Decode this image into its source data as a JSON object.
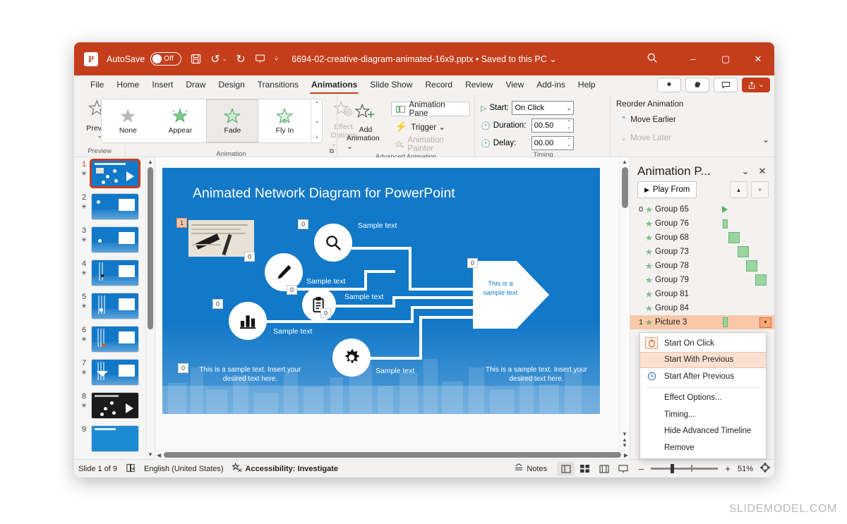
{
  "titlebar": {
    "app_logo": "powerpoint-logo",
    "autosave_label": "AutoSave",
    "autosave_state": "Off",
    "save_icon": "save-icon",
    "undo_icon": "undo-icon",
    "redo_icon": "redo-icon",
    "present_icon": "present-icon",
    "customize_icon": "chevron-down-icon",
    "document_title": "6694-02-creative-diagram-animated-16x9.pptx • Saved to this PC ⌄",
    "search_icon": "search-icon",
    "minimize": "–",
    "maximize": "▢",
    "close": "✕",
    "bg_color": "#c43e1c"
  },
  "tabs": [
    {
      "label": "File",
      "active": false
    },
    {
      "label": "Home",
      "active": false
    },
    {
      "label": "Insert",
      "active": false
    },
    {
      "label": "Draw",
      "active": false
    },
    {
      "label": "Design",
      "active": false
    },
    {
      "label": "Transitions",
      "active": false
    },
    {
      "label": "Animations",
      "active": true
    },
    {
      "label": "Slide Show",
      "active": false
    },
    {
      "label": "Record",
      "active": false
    },
    {
      "label": "Review",
      "active": false
    },
    {
      "label": "View",
      "active": false
    },
    {
      "label": "Add-ins",
      "active": false
    },
    {
      "label": "Help",
      "active": false
    }
  ],
  "tab_right": {
    "record_btn": "record-icon",
    "copilot_btn": "copilot-icon",
    "comments_btn": "comment-icon",
    "share_btn": "share-icon",
    "share_caret": "⌄"
  },
  "ribbon": {
    "preview": {
      "label": "Preview",
      "caret": "⌄",
      "group_title": "Preview",
      "icon": "preview-star-icon"
    },
    "animation": {
      "group_title": "Animation",
      "items": [
        {
          "label": "None",
          "icon": "star-outline-icon",
          "selected": false
        },
        {
          "label": "Appear",
          "icon": "star-appear-icon",
          "selected": false
        },
        {
          "label": "Fade",
          "icon": "star-fade-icon",
          "selected": true
        },
        {
          "label": "Fly In",
          "icon": "star-flyin-icon",
          "selected": false
        }
      ],
      "effect_options_label_1": "Effect",
      "effect_options_label_2": "Options ⌄",
      "effect_options_disabled": true,
      "dialog_launcher": "dialog-launcher-icon"
    },
    "advanced": {
      "group_title": "Advanced Animation",
      "add_animation_label_1": "Add",
      "add_animation_label_2": "Animation ⌄",
      "animation_pane_label": "Animation Pane",
      "trigger_label": "Trigger ⌄",
      "animation_painter_label": "Animation Painter",
      "animation_painter_disabled": true
    },
    "timing": {
      "group_title": "Timing",
      "start_label": "Start:",
      "start_value": "On Click",
      "duration_label": "Duration:",
      "duration_value": "00.50",
      "delay_label": "Delay:",
      "delay_value": "00.00",
      "reorder_title": "Reorder Animation",
      "move_earlier": "Move Earlier",
      "move_later": "Move Later",
      "move_later_disabled": true
    },
    "collapse_icon": "chevron-down-icon"
  },
  "thumbnails": {
    "slides": [
      {
        "number": "1",
        "selected": true,
        "style": "diagram"
      },
      {
        "number": "2",
        "selected": false,
        "style": "card"
      },
      {
        "number": "3",
        "selected": false,
        "style": "card"
      },
      {
        "number": "4",
        "selected": false,
        "style": "card"
      },
      {
        "number": "5",
        "selected": false,
        "style": "card"
      },
      {
        "number": "6",
        "selected": false,
        "style": "card"
      },
      {
        "number": "7",
        "selected": false,
        "style": "card"
      },
      {
        "number": "8",
        "selected": false,
        "style": "dark-diagram"
      },
      {
        "number": "9",
        "selected": false,
        "style": "card"
      }
    ],
    "animated_marker": "✳"
  },
  "slide": {
    "title": "Animated Network Diagram for PowerPoint",
    "nodes": [
      {
        "icon": "magnifier-icon",
        "label": "Sample text",
        "tag": "0"
      },
      {
        "icon": "pencil-icon",
        "label": "Sample text",
        "tag": "0"
      },
      {
        "icon": "clipboard-icon",
        "label": "Sample text",
        "tag": "0"
      },
      {
        "icon": "bar-chart-icon",
        "label": "Sample text",
        "tag": "0"
      },
      {
        "icon": "gear-icon",
        "label": "Sample text",
        "tag": "0"
      }
    ],
    "photo_tag": "1",
    "photo_tag2": "0",
    "arrow_tag": "0",
    "arrow_text": "This is a sample text",
    "left_text": "This is a sample text. Insert your desired text here.",
    "left_text_tag": "0",
    "right_text": "This is a sample text. Insert your desired text here.",
    "node_tags": [
      "0",
      "0",
      "0",
      "0",
      "0"
    ],
    "bg_color": "#1278c8"
  },
  "animation_pane": {
    "title": "Animation P...",
    "collapse_icon": "chevron-down-icon",
    "close_icon": "close-icon",
    "play_from_label": "Play From",
    "play_icon": "play-icon",
    "up_icon": "arrow-up-icon",
    "down_icon": "arrow-down-icon",
    "items": [
      {
        "index": "0",
        "name": "Group 65",
        "marker": "trigger",
        "selected": false
      },
      {
        "index": "",
        "name": "Group 76",
        "marker": "bar",
        "selected": false
      },
      {
        "index": "",
        "name": "Group 68",
        "marker": "bar",
        "selected": false
      },
      {
        "index": "",
        "name": "Group 73",
        "marker": "bar",
        "selected": false
      },
      {
        "index": "",
        "name": "Group 78",
        "marker": "bar",
        "selected": false
      },
      {
        "index": "",
        "name": "Group 79",
        "marker": "bar",
        "selected": false
      },
      {
        "index": "",
        "name": "Group 81",
        "marker": "none",
        "selected": false
      },
      {
        "index": "",
        "name": "Group 84",
        "marker": "none",
        "selected": false
      },
      {
        "index": "1",
        "name": "Picture 3",
        "marker": "bar",
        "selected": true
      }
    ]
  },
  "context_menu": {
    "items": [
      {
        "label": "Start On Click",
        "icon": "mouse-icon",
        "highlighted": false,
        "separator_after": false
      },
      {
        "label": "Start With Previous",
        "icon": "none",
        "highlighted": true,
        "separator_after": false
      },
      {
        "label": "Start After Previous",
        "icon": "clock-icon",
        "highlighted": false,
        "separator_after": true
      },
      {
        "label": "Effect Options...",
        "icon": "none",
        "highlighted": false,
        "separator_after": false
      },
      {
        "label": "Timing...",
        "icon": "none",
        "highlighted": false,
        "separator_after": false
      },
      {
        "label": "Hide Advanced Timeline",
        "icon": "none",
        "highlighted": false,
        "separator_after": false
      },
      {
        "label": "Remove",
        "icon": "none",
        "highlighted": false,
        "separator_after": false
      }
    ]
  },
  "statusbar": {
    "slide_counter": "Slide 1 of 9",
    "language_icon": "spellcheck-icon",
    "language": "English (United States)",
    "accessibility_icon": "accessibility-icon",
    "accessibility": "Accessibility: Investigate",
    "notes_label": "Notes",
    "notes_icon": "notes-icon",
    "views": [
      {
        "icon": "normal-view-icon",
        "selected": true
      },
      {
        "icon": "slide-sorter-icon",
        "selected": false
      },
      {
        "icon": "reading-view-icon",
        "selected": false
      },
      {
        "icon": "slideshow-icon",
        "selected": false
      }
    ],
    "zoom_out": "–",
    "zoom_in": "+",
    "zoom_level": "51%",
    "fit_icon": "fit-slide-icon"
  },
  "watermark": "SLIDEMODEL.COM"
}
